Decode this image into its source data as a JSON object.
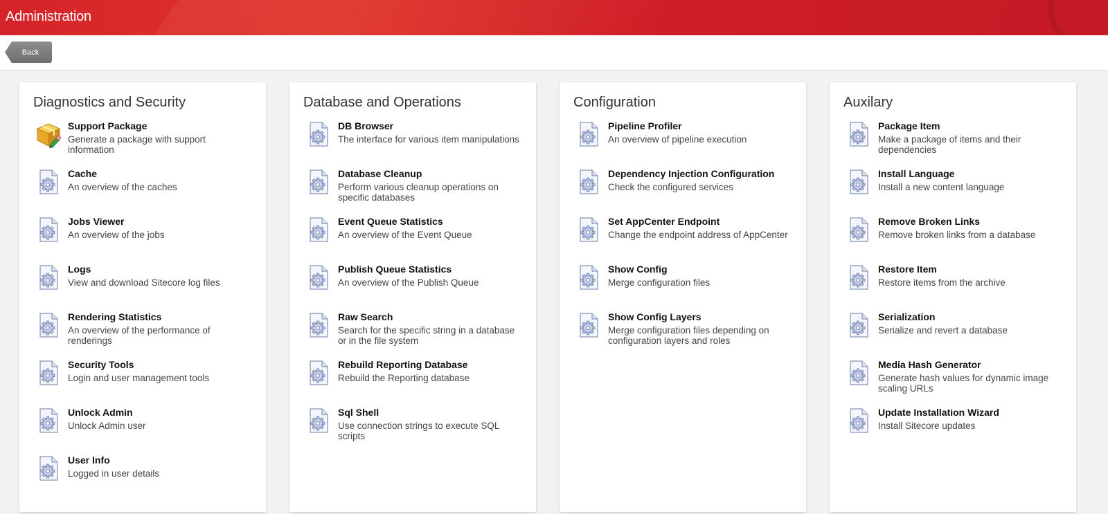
{
  "header": {
    "title": "Administration"
  },
  "toolbar": {
    "back_label": "Back"
  },
  "panels": [
    {
      "title": "Diagnostics and Security",
      "items": [
        {
          "name": "Support Package",
          "desc": "Generate a package with support information",
          "icon": "package-icon"
        },
        {
          "name": "Cache",
          "desc": "An overview of the caches",
          "icon": "gear-document-icon"
        },
        {
          "name": "Jobs Viewer",
          "desc": "An overview of the jobs",
          "icon": "gear-document-icon"
        },
        {
          "name": "Logs",
          "desc": "View and download Sitecore log files",
          "icon": "gear-document-icon"
        },
        {
          "name": "Rendering Statistics",
          "desc": "An overview of the performance of renderings",
          "icon": "gear-document-icon"
        },
        {
          "name": "Security Tools",
          "desc": "Login and user management tools",
          "icon": "gear-document-icon"
        },
        {
          "name": "Unlock Admin",
          "desc": "Unlock Admin user",
          "icon": "gear-document-icon"
        },
        {
          "name": "User Info",
          "desc": "Logged in user details",
          "icon": "gear-document-icon"
        }
      ]
    },
    {
      "title": "Database and Operations",
      "items": [
        {
          "name": "DB Browser",
          "desc": "The interface for various item manipulations",
          "icon": "gear-document-icon"
        },
        {
          "name": "Database Cleanup",
          "desc": "Perform various cleanup operations on specific databases",
          "icon": "gear-document-icon"
        },
        {
          "name": "Event Queue Statistics",
          "desc": "An overview of the Event Queue",
          "icon": "gear-document-icon"
        },
        {
          "name": "Publish Queue Statistics",
          "desc": "An overview of the Publish Queue",
          "icon": "gear-document-icon"
        },
        {
          "name": "Raw Search",
          "desc": "Search for the specific string in a database or in the file system",
          "icon": "gear-document-icon"
        },
        {
          "name": "Rebuild Reporting Database",
          "desc": "Rebuild the Reporting database",
          "icon": "gear-document-icon"
        },
        {
          "name": "Sql Shell",
          "desc": "Use connection strings to execute SQL scripts",
          "icon": "gear-document-icon"
        }
      ]
    },
    {
      "title": "Configuration",
      "items": [
        {
          "name": "Pipeline Profiler",
          "desc": "An overview of pipeline execution",
          "icon": "gear-document-icon"
        },
        {
          "name": "Dependency Injection Configuration",
          "desc": "Check the configured services",
          "icon": "gear-document-icon"
        },
        {
          "name": "Set AppCenter Endpoint",
          "desc": "Change the endpoint address of AppCenter",
          "icon": "gear-document-icon"
        },
        {
          "name": "Show Config",
          "desc": "Merge configuration files",
          "icon": "gear-document-icon"
        },
        {
          "name": "Show Config Layers",
          "desc": "Merge configuration files depending on configuration layers and roles",
          "icon": "gear-document-icon"
        }
      ]
    },
    {
      "title": "Auxilary",
      "items": [
        {
          "name": "Package Item",
          "desc": "Make a package of items and their dependencies",
          "icon": "gear-document-icon"
        },
        {
          "name": "Install Language",
          "desc": "Install a new content language",
          "icon": "gear-document-icon"
        },
        {
          "name": "Remove Broken Links",
          "desc": "Remove broken links from a database",
          "icon": "gear-document-icon"
        },
        {
          "name": "Restore Item",
          "desc": "Restore items from the archive",
          "icon": "gear-document-icon"
        },
        {
          "name": "Serialization",
          "desc": "Serialize and revert a database",
          "icon": "gear-document-icon"
        },
        {
          "name": "Media Hash Generator",
          "desc": "Generate hash values for dynamic image scaling URLs",
          "icon": "gear-document-icon"
        },
        {
          "name": "Update Installation Wizard",
          "desc": "Install Sitecore updates",
          "icon": "gear-document-icon"
        }
      ]
    }
  ]
}
